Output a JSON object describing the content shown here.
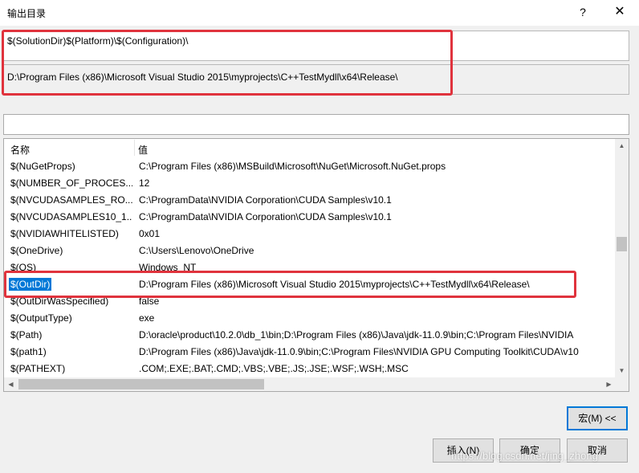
{
  "dialog": {
    "title": "输出目录",
    "help_glyph": "?",
    "close_glyph": "✕"
  },
  "macro_input": {
    "value": "$(SolutionDir)$(Platform)\\$(Configuration)\\"
  },
  "evaluated": {
    "value": "D:\\Program Files (x86)\\Microsoft Visual Studio 2015\\myprojects\\C++TestMydll\\x64\\Release\\"
  },
  "filter": {
    "value": ""
  },
  "table": {
    "headers": {
      "name": "名称",
      "value": "值"
    },
    "rows": [
      {
        "name": "$(NuGetProps)",
        "value": "C:\\Program Files (x86)\\MSBuild\\Microsoft\\NuGet\\Microsoft.NuGet.props"
      },
      {
        "name": "$(NUMBER_OF_PROCES...",
        "value": "12"
      },
      {
        "name": "$(NVCUDASAMPLES_RO...",
        "value": "C:\\ProgramData\\NVIDIA Corporation\\CUDA Samples\\v10.1"
      },
      {
        "name": "$(NVCUDASAMPLES10_1...",
        "value": "C:\\ProgramData\\NVIDIA Corporation\\CUDA Samples\\v10.1"
      },
      {
        "name": "$(NVIDIAWHITELISTED)",
        "value": "0x01"
      },
      {
        "name": "$(OneDrive)",
        "value": "C:\\Users\\Lenovo\\OneDrive"
      },
      {
        "name": "$(OS)",
        "value": "Windows_NT"
      },
      {
        "name": "$(OutDir)",
        "value": "D:\\Program Files (x86)\\Microsoft Visual Studio 2015\\myprojects\\C++TestMydll\\x64\\Release\\"
      },
      {
        "name": "$(OutDirWasSpecified)",
        "value": "false"
      },
      {
        "name": "$(OutputType)",
        "value": "exe"
      },
      {
        "name": "$(Path)",
        "value": "D:\\oracle\\product\\10.2.0\\db_1\\bin;D:\\Program Files (x86)\\Java\\jdk-11.0.9\\bin;C:\\Program Files\\NVIDIA"
      },
      {
        "name": "$(path1)",
        "value": "D:\\Program Files (x86)\\Java\\jdk-11.0.9\\bin;C:\\Program Files\\NVIDIA GPU Computing Toolkit\\CUDA\\v10"
      },
      {
        "name": "$(PATHEXT)",
        "value": ".COM;.EXE;.BAT;.CMD;.VBS;.VBE;.JS;.JSE;.WSF;.WSH;.MSC"
      }
    ],
    "selected_index": 7
  },
  "buttons": {
    "macro": "宏(M) <<",
    "insert": "插入(N)",
    "ok": "确定",
    "cancel": "取消"
  },
  "watermark": "https://blog.csdn.net/jing_zhong",
  "colors": {
    "selection": "#0078d7",
    "annotation_red": "#e0333d"
  }
}
